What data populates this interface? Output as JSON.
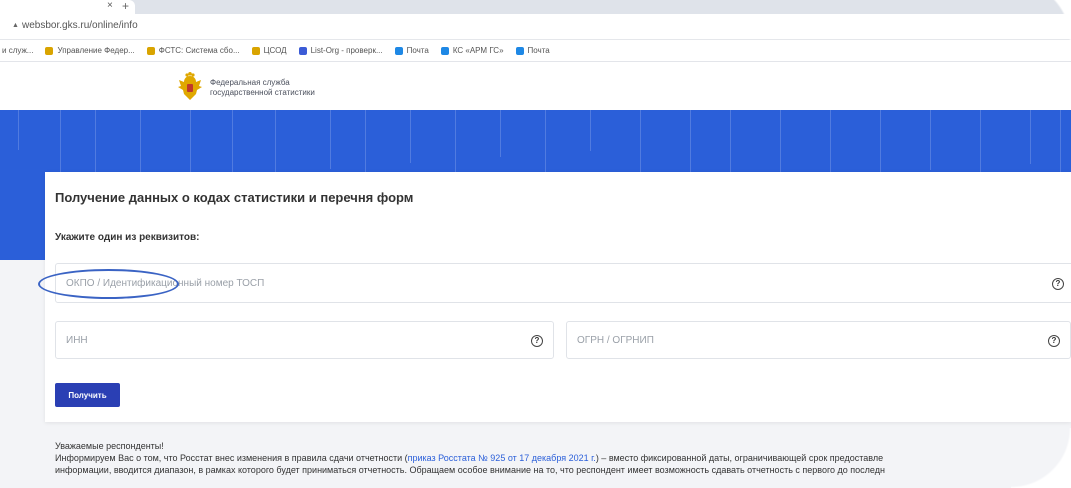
{
  "browser": {
    "tab_close": "×",
    "tab_new": "+",
    "url": "websbor.gks.ru/online/info",
    "bookmarks": [
      {
        "label": "и служ...",
        "icon": "folder-icon",
        "color": "#cccccc"
      },
      {
        "label": "Управление Федер...",
        "icon": "emblem-icon",
        "color": "#d9a400"
      },
      {
        "label": "ФСТС: Система сбо...",
        "icon": "emblem-icon",
        "color": "#d9a400"
      },
      {
        "label": "ЦСОД",
        "icon": "emblem-icon",
        "color": "#d9a400"
      },
      {
        "label": "List-Org - проверк...",
        "icon": "listorg-icon",
        "color": "#3b5bd6"
      },
      {
        "label": "Почта",
        "icon": "mail-icon",
        "color": "#1e88e5"
      },
      {
        "label": "КС «АРМ ГС»",
        "icon": "mail-icon",
        "color": "#1e88e5"
      },
      {
        "label": "Почта",
        "icon": "mail-icon",
        "color": "#1e88e5"
      }
    ]
  },
  "header": {
    "org_line1": "Федеральная служба",
    "org_line2": "государственной статистики",
    "logo_icon": "double-headed-eagle-icon"
  },
  "form": {
    "title": "Получение данных о кодах статистики и перечня форм",
    "hint": "Укажите один из реквизитов:",
    "okpo_placeholder": "ОКПО / Идентификационный номер ТОСП",
    "inn_placeholder": "ИНН",
    "ogrn_placeholder": "ОГРН / ОГРНИП",
    "help_glyph": "?",
    "submit_label": "Получить"
  },
  "notice": {
    "greeting": "Уважаемые респонденты!",
    "line1_before": " Информируем Вас о том, что Росстат внес изменения в правила сдачи отчетности (",
    "link": "приказ Росстата № 925 от 17 декабря 2021 г.",
    "line1_after": ") – вместо фиксированной даты, ограничивающей срок предоставле",
    "line2": "информации, вводится диапазон, в рамках которого будет приниматься отчетность. Обращаем особое внимание на то, что респондент имеет возможность сдавать отчетность с первого до последн"
  },
  "colors": {
    "banner": "#2b5fd9",
    "button": "#2a3fb4",
    "annotation_ellipse": "#3a63c4",
    "link": "#2b5fd9"
  }
}
